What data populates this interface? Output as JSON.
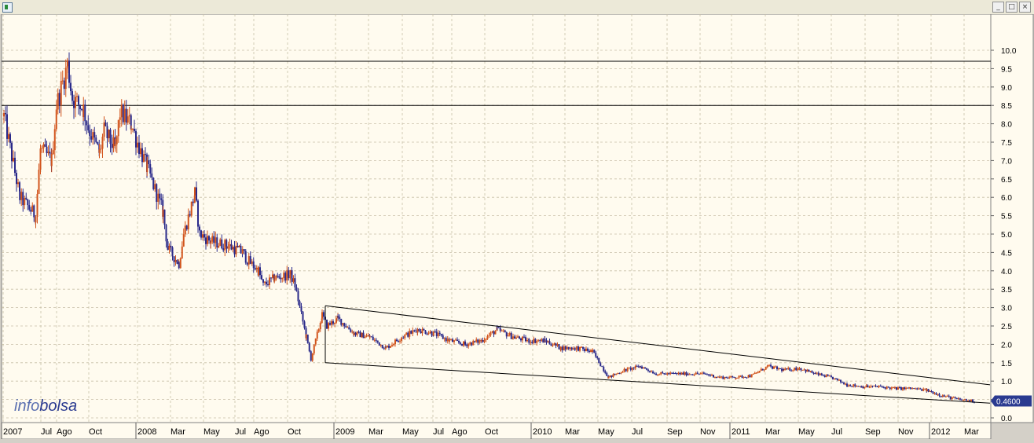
{
  "window": {
    "controls": {
      "minimize": "_",
      "maximize": "□",
      "close": "×"
    }
  },
  "watermark": {
    "part1": "info",
    "part2": "bolsa",
    "color1": "#5a6fb0",
    "color2": "#2a3a90"
  },
  "colors": {
    "background": "#fffbef",
    "grid": "#c8c0a8",
    "up": "#d2541c",
    "down": "#2a2a8a",
    "price_tag": "#2a3a90"
  },
  "chart_data": {
    "type": "candlestick",
    "title": "",
    "x_ticks": [
      "2007",
      "Jul",
      "Ago",
      "Oct",
      "2008",
      "Mar",
      "May",
      "Jul",
      "Ago",
      "Oct",
      "2009",
      "Mar",
      "May",
      "Jul",
      "Ago",
      "Oct",
      "2010",
      "Mar",
      "May",
      "Jul",
      "Sep",
      "Nov",
      "2011",
      "Mar",
      "May",
      "Jul",
      "Sep",
      "Nov",
      "2012",
      "Mar"
    ],
    "y_ticks": [
      "0.0",
      "0.5",
      "1.0",
      "1.5",
      "2.0",
      "2.5",
      "3.0",
      "3.5",
      "4.0",
      "4.5",
      "5.0",
      "5.5",
      "6.0",
      "6.5",
      "7.0",
      "7.5",
      "8.0",
      "8.5",
      "9.0",
      "9.5",
      "10.0"
    ],
    "ylim": [
      -0.25,
      10.5
    ],
    "grid": true,
    "last_price": "0.4600",
    "price_path": [
      [
        "2007-03",
        8.2
      ],
      [
        "2007-04",
        6.0
      ],
      [
        "2007-05",
        5.5
      ],
      [
        "2007-05",
        7.3
      ],
      [
        "2007-06",
        7.0
      ],
      [
        "2007-06",
        8.5
      ],
      [
        "2007-07",
        9.6
      ],
      [
        "2007-07",
        8.7
      ],
      [
        "2007-08",
        8.4
      ],
      [
        "2007-08",
        7.9
      ],
      [
        "2007-09",
        7.2
      ],
      [
        "2007-09",
        7.8
      ],
      [
        "2007-10",
        7.3
      ],
      [
        "2007-10",
        8.3
      ],
      [
        "2007-11",
        8.0
      ],
      [
        "2007-11",
        7.6
      ],
      [
        "2007-12",
        6.8
      ],
      [
        "2008-01",
        5.6
      ],
      [
        "2008-01",
        4.6
      ],
      [
        "2008-02",
        4.2
      ],
      [
        "2008-02",
        5.0
      ],
      [
        "2008-03",
        6.1
      ],
      [
        "2008-03",
        5.0
      ],
      [
        "2008-04",
        4.8
      ],
      [
        "2008-05",
        4.7
      ],
      [
        "2008-06",
        4.5
      ],
      [
        "2008-06",
        4.3
      ],
      [
        "2008-07",
        4.0
      ],
      [
        "2008-07",
        3.6
      ],
      [
        "2008-08",
        3.8
      ],
      [
        "2008-09",
        3.9
      ],
      [
        "2008-09",
        3.6
      ],
      [
        "2008-10",
        2.2
      ],
      [
        "2008-10",
        1.6
      ],
      [
        "2008-11",
        2.8
      ],
      [
        "2008-11",
        2.5
      ],
      [
        "2008-12",
        2.7
      ],
      [
        "2009-01",
        2.3
      ],
      [
        "2009-02",
        2.2
      ],
      [
        "2009-03",
        1.9
      ],
      [
        "2009-04",
        2.2
      ],
      [
        "2009-05",
        2.4
      ],
      [
        "2009-06",
        2.3
      ],
      [
        "2009-07",
        2.1
      ],
      [
        "2009-08",
        2.0
      ],
      [
        "2009-09",
        2.1
      ],
      [
        "2009-10",
        2.4
      ],
      [
        "2009-11",
        2.2
      ],
      [
        "2009-12",
        2.1
      ],
      [
        "2010-01",
        2.1
      ],
      [
        "2010-02",
        1.9
      ],
      [
        "2010-03",
        1.9
      ],
      [
        "2010-04",
        1.8
      ],
      [
        "2010-05",
        1.1
      ],
      [
        "2010-06",
        1.3
      ],
      [
        "2010-07",
        1.4
      ],
      [
        "2010-08",
        1.2
      ],
      [
        "2010-09",
        1.2
      ],
      [
        "2010-10",
        1.2
      ],
      [
        "2010-11",
        1.2
      ],
      [
        "2010-12",
        1.1
      ],
      [
        "2011-01",
        1.1
      ],
      [
        "2011-02",
        1.15
      ],
      [
        "2011-03",
        1.4
      ],
      [
        "2011-04",
        1.3
      ],
      [
        "2011-05",
        1.35
      ],
      [
        "2011-06",
        1.2
      ],
      [
        "2011-07",
        1.1
      ],
      [
        "2011-08",
        0.9
      ],
      [
        "2011-09",
        0.85
      ],
      [
        "2011-10",
        0.85
      ],
      [
        "2011-11",
        0.8
      ],
      [
        "2011-12",
        0.8
      ],
      [
        "2012-01",
        0.75
      ],
      [
        "2012-02",
        0.6
      ],
      [
        "2012-03",
        0.5
      ],
      [
        "2012-04",
        0.46
      ]
    ],
    "horizontal_levels": [
      9.7,
      8.5
    ],
    "trendlines": [
      {
        "from": [
          "2008-11",
          3.05
        ],
        "to": [
          "2012-04",
          0.9
        ]
      },
      {
        "from": [
          "2008-11",
          1.5
        ],
        "to": [
          "2012-04",
          0.4
        ]
      },
      {
        "from": [
          "2008-11",
          1.5
        ],
        "to": [
          "2008-11",
          3.05
        ]
      }
    ]
  }
}
